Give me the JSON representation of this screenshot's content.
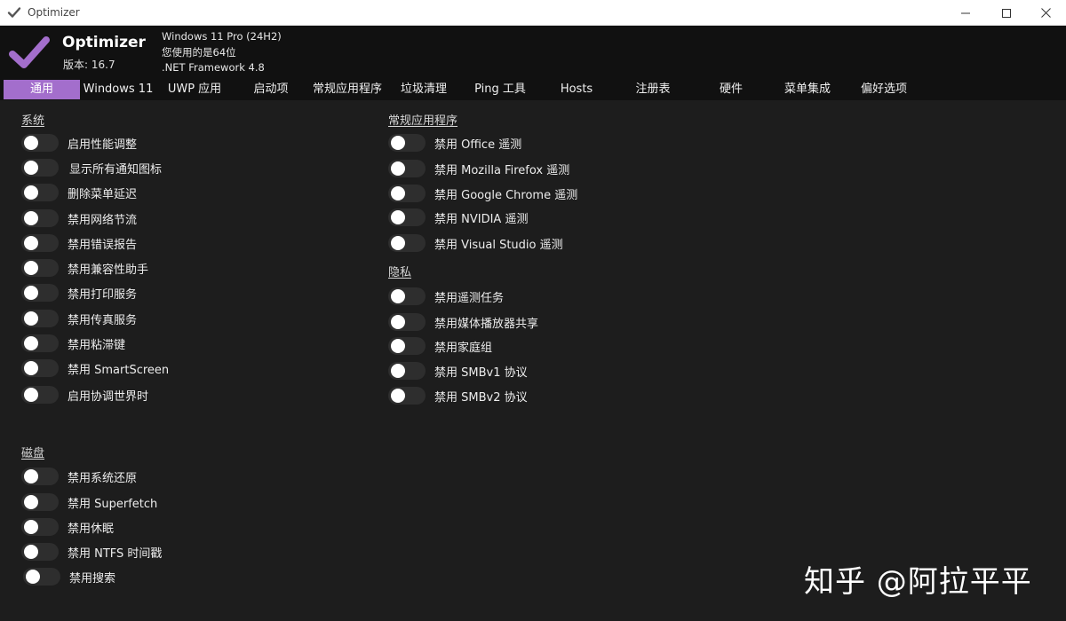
{
  "window": {
    "title": "Optimizer",
    "icon": "check-icon",
    "controls": [
      "minimize-icon",
      "maximize-icon",
      "close-icon"
    ]
  },
  "header": {
    "app_name": "Optimizer",
    "version": "版本: 16.7",
    "os": "Windows 11 Pro (24H2)",
    "arch": "您使用的是64位",
    "framework": ".NET Framework 4.8",
    "accent_color": "#a36ecc"
  },
  "tabs": [
    {
      "label": "通用",
      "active": true
    },
    {
      "label": "Windows 11",
      "active": false
    },
    {
      "label": "UWP 应用",
      "active": false
    },
    {
      "label": "启动项",
      "active": false
    },
    {
      "label": "常规应用程序",
      "active": false
    },
    {
      "label": "垃圾清理",
      "active": false
    },
    {
      "label": "Ping 工具",
      "active": false
    },
    {
      "label": "Hosts",
      "active": false
    },
    {
      "label": "注册表",
      "active": false
    },
    {
      "label": "硬件",
      "active": false
    },
    {
      "label": "菜单集成",
      "active": false
    },
    {
      "label": "偏好选项",
      "active": false
    }
  ],
  "sections": {
    "system": {
      "title": "系统",
      "items": [
        {
          "label": "启用性能调整",
          "on": false
        },
        {
          "label": "显示所有通知图标",
          "on": false
        },
        {
          "label": "删除菜单延迟",
          "on": false
        },
        {
          "label": "禁用网络节流",
          "on": false
        },
        {
          "label": "禁用错误报告",
          "on": false
        },
        {
          "label": "禁用兼容性助手",
          "on": false
        },
        {
          "label": "禁用打印服务",
          "on": false
        },
        {
          "label": "禁用传真服务",
          "on": false
        },
        {
          "label": "禁用粘滞键",
          "on": false
        },
        {
          "label": "禁用 SmartScreen",
          "on": false
        },
        {
          "label": "启用协调世界时",
          "on": false
        }
      ]
    },
    "disk": {
      "title": "磁盘",
      "items": [
        {
          "label": "禁用系统还原",
          "on": false
        },
        {
          "label": "禁用 Superfetch",
          "on": false
        },
        {
          "label": "禁用休眠",
          "on": false
        },
        {
          "label": "禁用 NTFS 时间戳",
          "on": false
        },
        {
          "label": "禁用搜索",
          "on": false
        }
      ]
    },
    "apps": {
      "title": "常规应用程序",
      "items": [
        {
          "label": "禁用 Office 遥测",
          "on": false
        },
        {
          "label": "禁用 Mozilla Firefox 遥测",
          "on": false
        },
        {
          "label": "禁用 Google Chrome 遥测",
          "on": false
        },
        {
          "label": "禁用 NVIDIA 遥测",
          "on": false
        },
        {
          "label": "禁用 Visual Studio 遥测",
          "on": false
        }
      ]
    },
    "privacy": {
      "title": "隐私",
      "items": [
        {
          "label": "禁用遥测任务",
          "on": false
        },
        {
          "label": "禁用媒体播放器共享",
          "on": false
        },
        {
          "label": "禁用家庭组",
          "on": false
        },
        {
          "label": "禁用 SMBv1 协议",
          "on": false
        },
        {
          "label": "禁用 SMBv2 协议",
          "on": false
        }
      ]
    }
  },
  "watermark": "知乎 @阿拉平平"
}
